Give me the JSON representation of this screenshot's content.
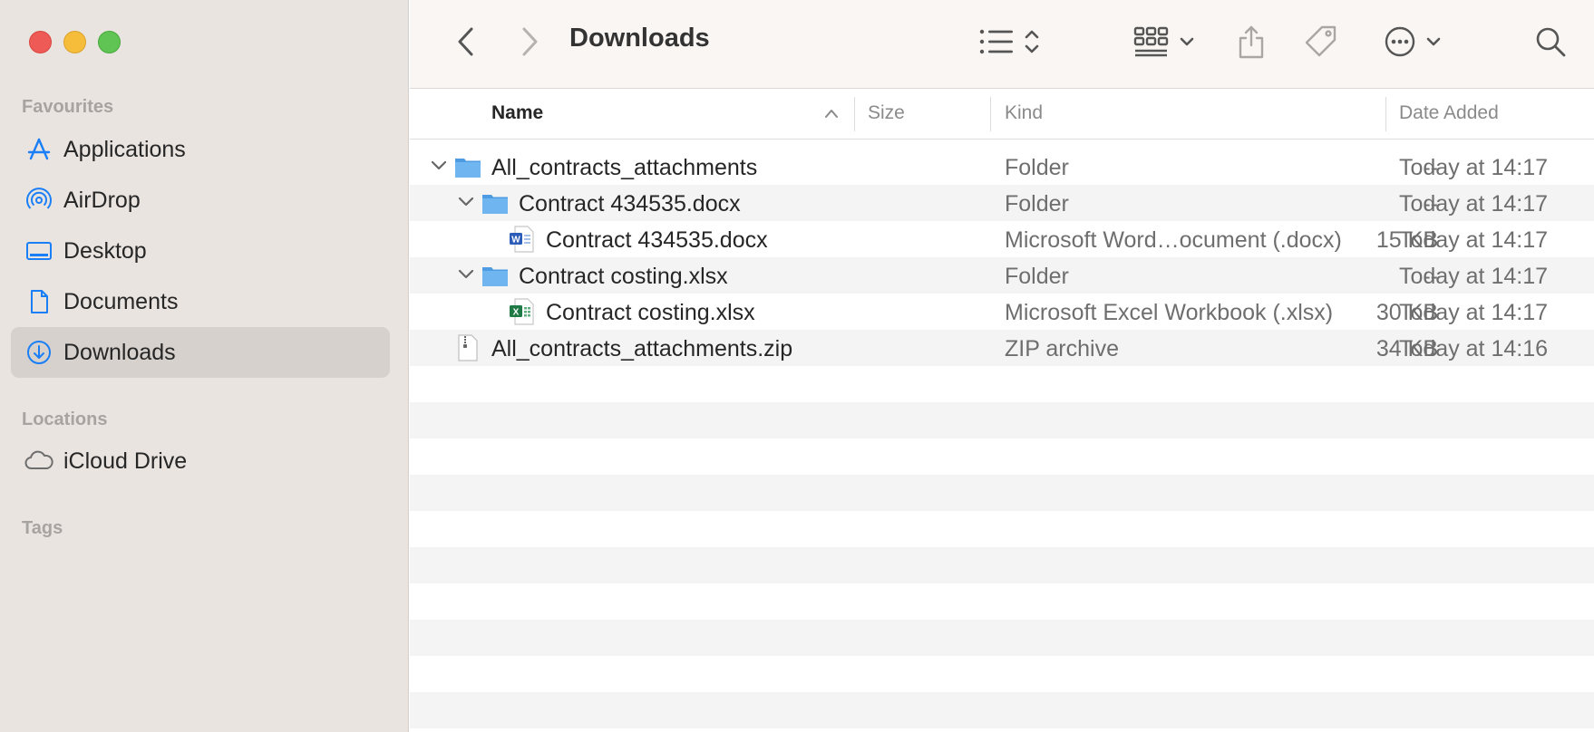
{
  "window": {
    "title": "Downloads"
  },
  "sidebar": {
    "favourites_label": "Favourites",
    "locations_label": "Locations",
    "tags_label": "Tags",
    "favourites": [
      {
        "label": "Applications",
        "icon": "applications-icon"
      },
      {
        "label": "AirDrop",
        "icon": "airdrop-icon"
      },
      {
        "label": "Desktop",
        "icon": "desktop-icon"
      },
      {
        "label": "Documents",
        "icon": "document-icon"
      },
      {
        "label": "Downloads",
        "icon": "downloads-icon",
        "selected": true
      }
    ],
    "locations": [
      {
        "label": "iCloud Drive",
        "icon": "icloud-icon"
      }
    ]
  },
  "columns": {
    "name": "Name",
    "size": "Size",
    "kind": "Kind",
    "date_added": "Date Added",
    "sort": "Name ascending"
  },
  "files": [
    {
      "name": "All_contracts_attachments",
      "size": "--",
      "kind": "Folder",
      "date": "Today at 14:17",
      "type": "folder",
      "expanded": true,
      "level": 0
    },
    {
      "name": "Contract 434535.docx",
      "size": "--",
      "kind": "Folder",
      "date": "Today at 14:17",
      "type": "folder",
      "expanded": true,
      "level": 1
    },
    {
      "name": "Contract 434535.docx",
      "size": "15 KB",
      "kind": "Microsoft Word…ocument (.docx)",
      "date": "Today at 14:17",
      "type": "word",
      "level": 2
    },
    {
      "name": "Contract costing.xlsx",
      "size": "--",
      "kind": "Folder",
      "date": "Today at 14:17",
      "type": "folder",
      "expanded": true,
      "level": 1
    },
    {
      "name": "Contract costing.xlsx",
      "size": "30 KB",
      "kind": "Microsoft Excel Workbook (.xlsx)",
      "date": "Today at 14:17",
      "type": "excel",
      "level": 2
    },
    {
      "name": "All_contracts_attachments.zip",
      "size": "34 KB",
      "kind": "ZIP archive",
      "date": "Today at 14:16",
      "type": "zip",
      "level": 0
    }
  ],
  "colors": {
    "accent": "#1a7ff6",
    "sidebar_bg": "#e9e4e0",
    "folder": "#5aa6e8"
  }
}
